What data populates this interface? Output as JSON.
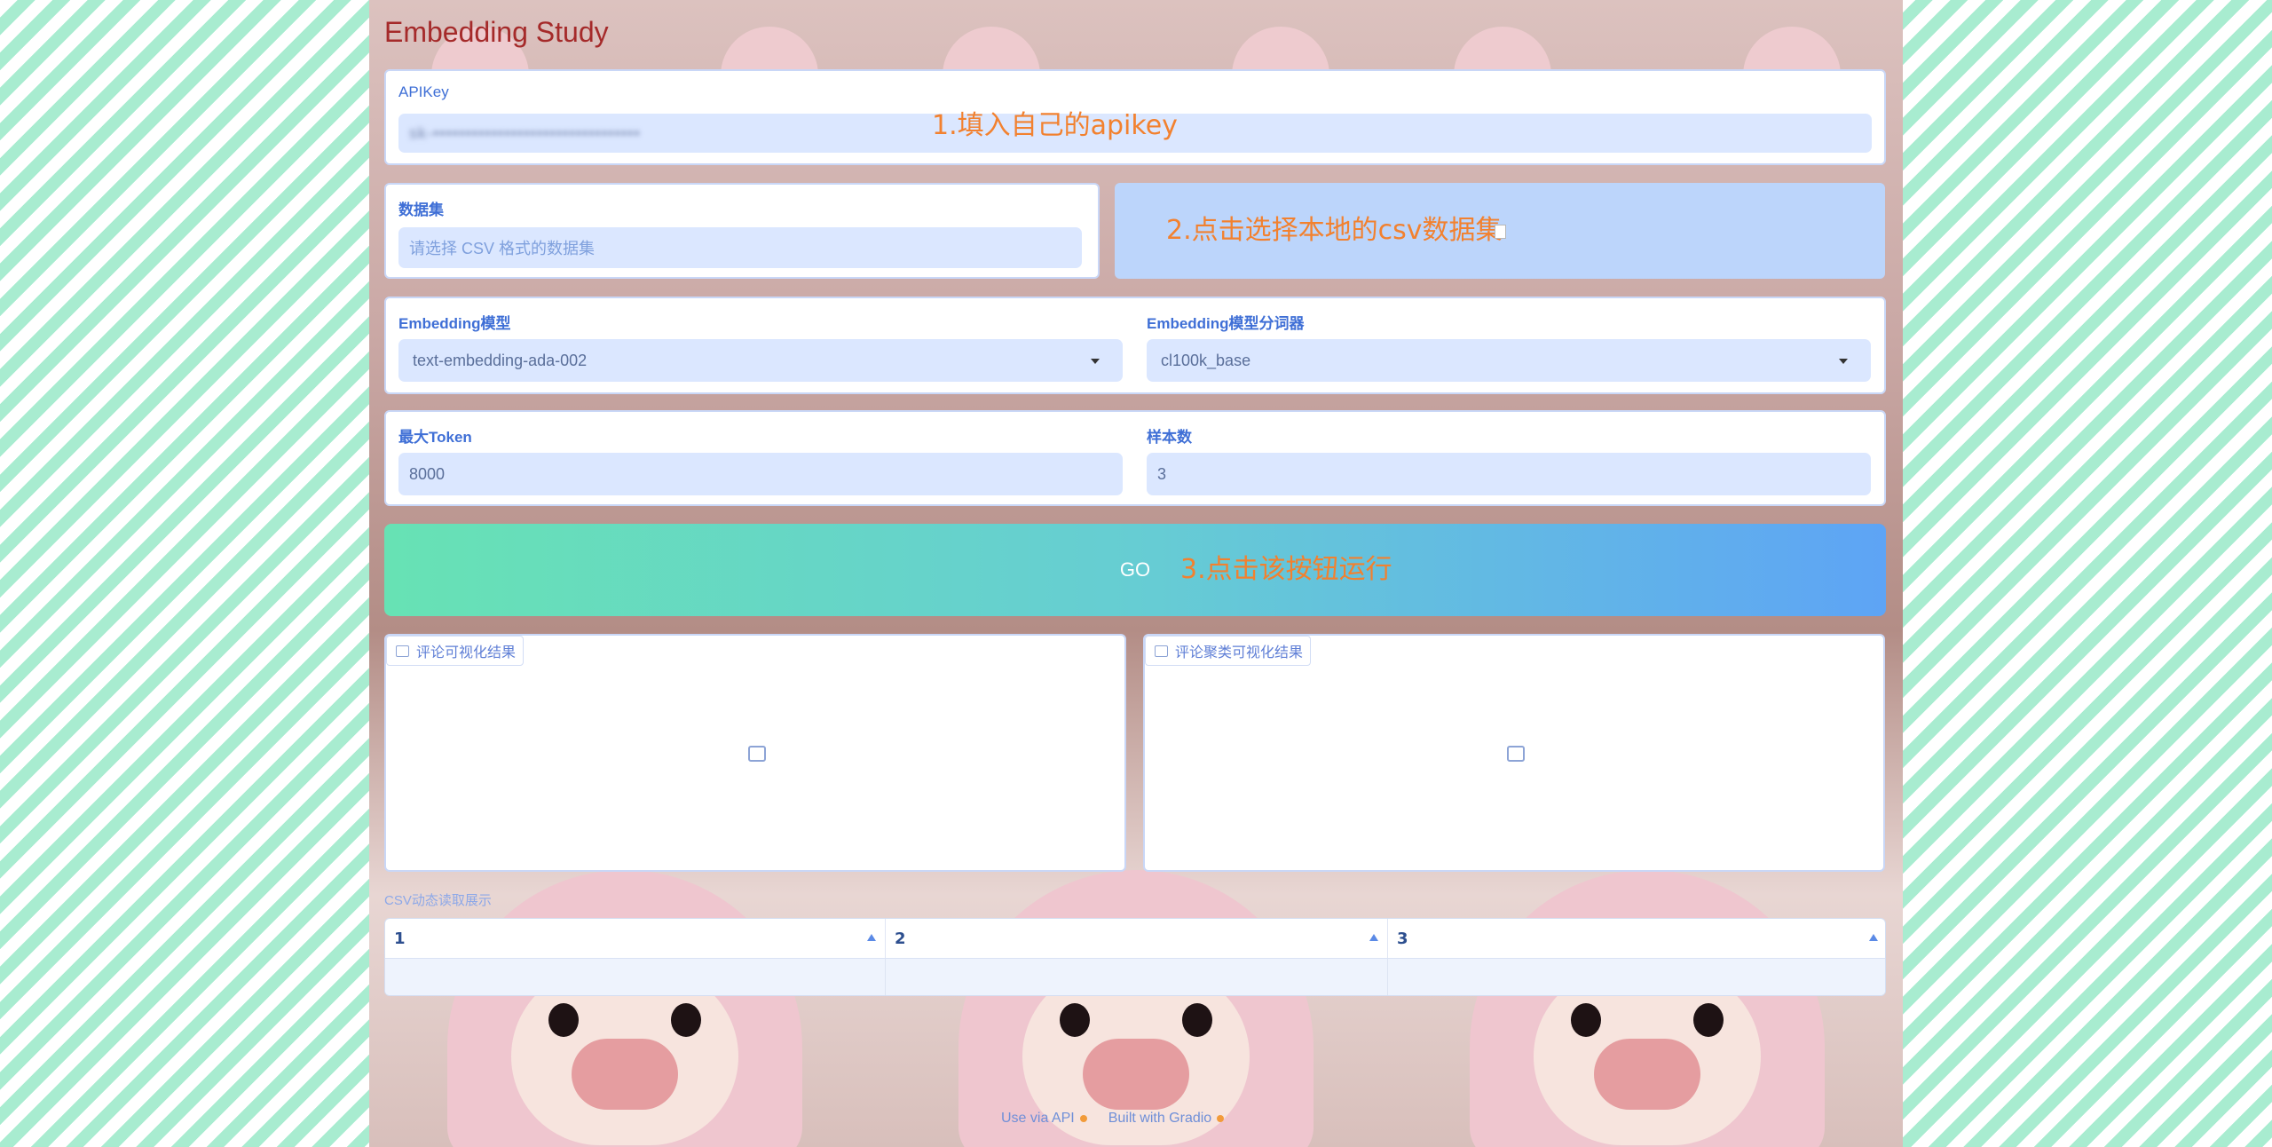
{
  "app": {
    "title": "Embedding Study"
  },
  "apikey": {
    "label": "APIKey",
    "value": "sk-••••••••••••••••••••••••••••••••"
  },
  "dataset": {
    "label": "数据集",
    "placeholder": "请选择 CSV 格式的数据集"
  },
  "model": {
    "label": "Embedding模型",
    "value": "text-embedding-ada-002"
  },
  "tokenizer": {
    "label": "Embedding模型分词器",
    "value": "cl100k_base"
  },
  "max_token": {
    "label": "最大Token",
    "value": "8000"
  },
  "samples": {
    "label": "样本数",
    "value": "3"
  },
  "go": {
    "label": "GO"
  },
  "annotations": {
    "step1": "1.填入自己的apikey",
    "step2": "2.点击选择本地的csv数据集",
    "step3": "3.点击该按钮运行"
  },
  "outputs": {
    "comments_viz": "评论可视化结果",
    "cluster_viz": "评论聚类可视化结果"
  },
  "csv_table": {
    "label": "CSV动态读取展示",
    "headers": [
      "1",
      "2",
      "3"
    ],
    "rows": [
      [
        "",
        "",
        ""
      ]
    ]
  },
  "footer": {
    "api_link": "Use via API",
    "built_with": "Built with Gradio"
  }
}
